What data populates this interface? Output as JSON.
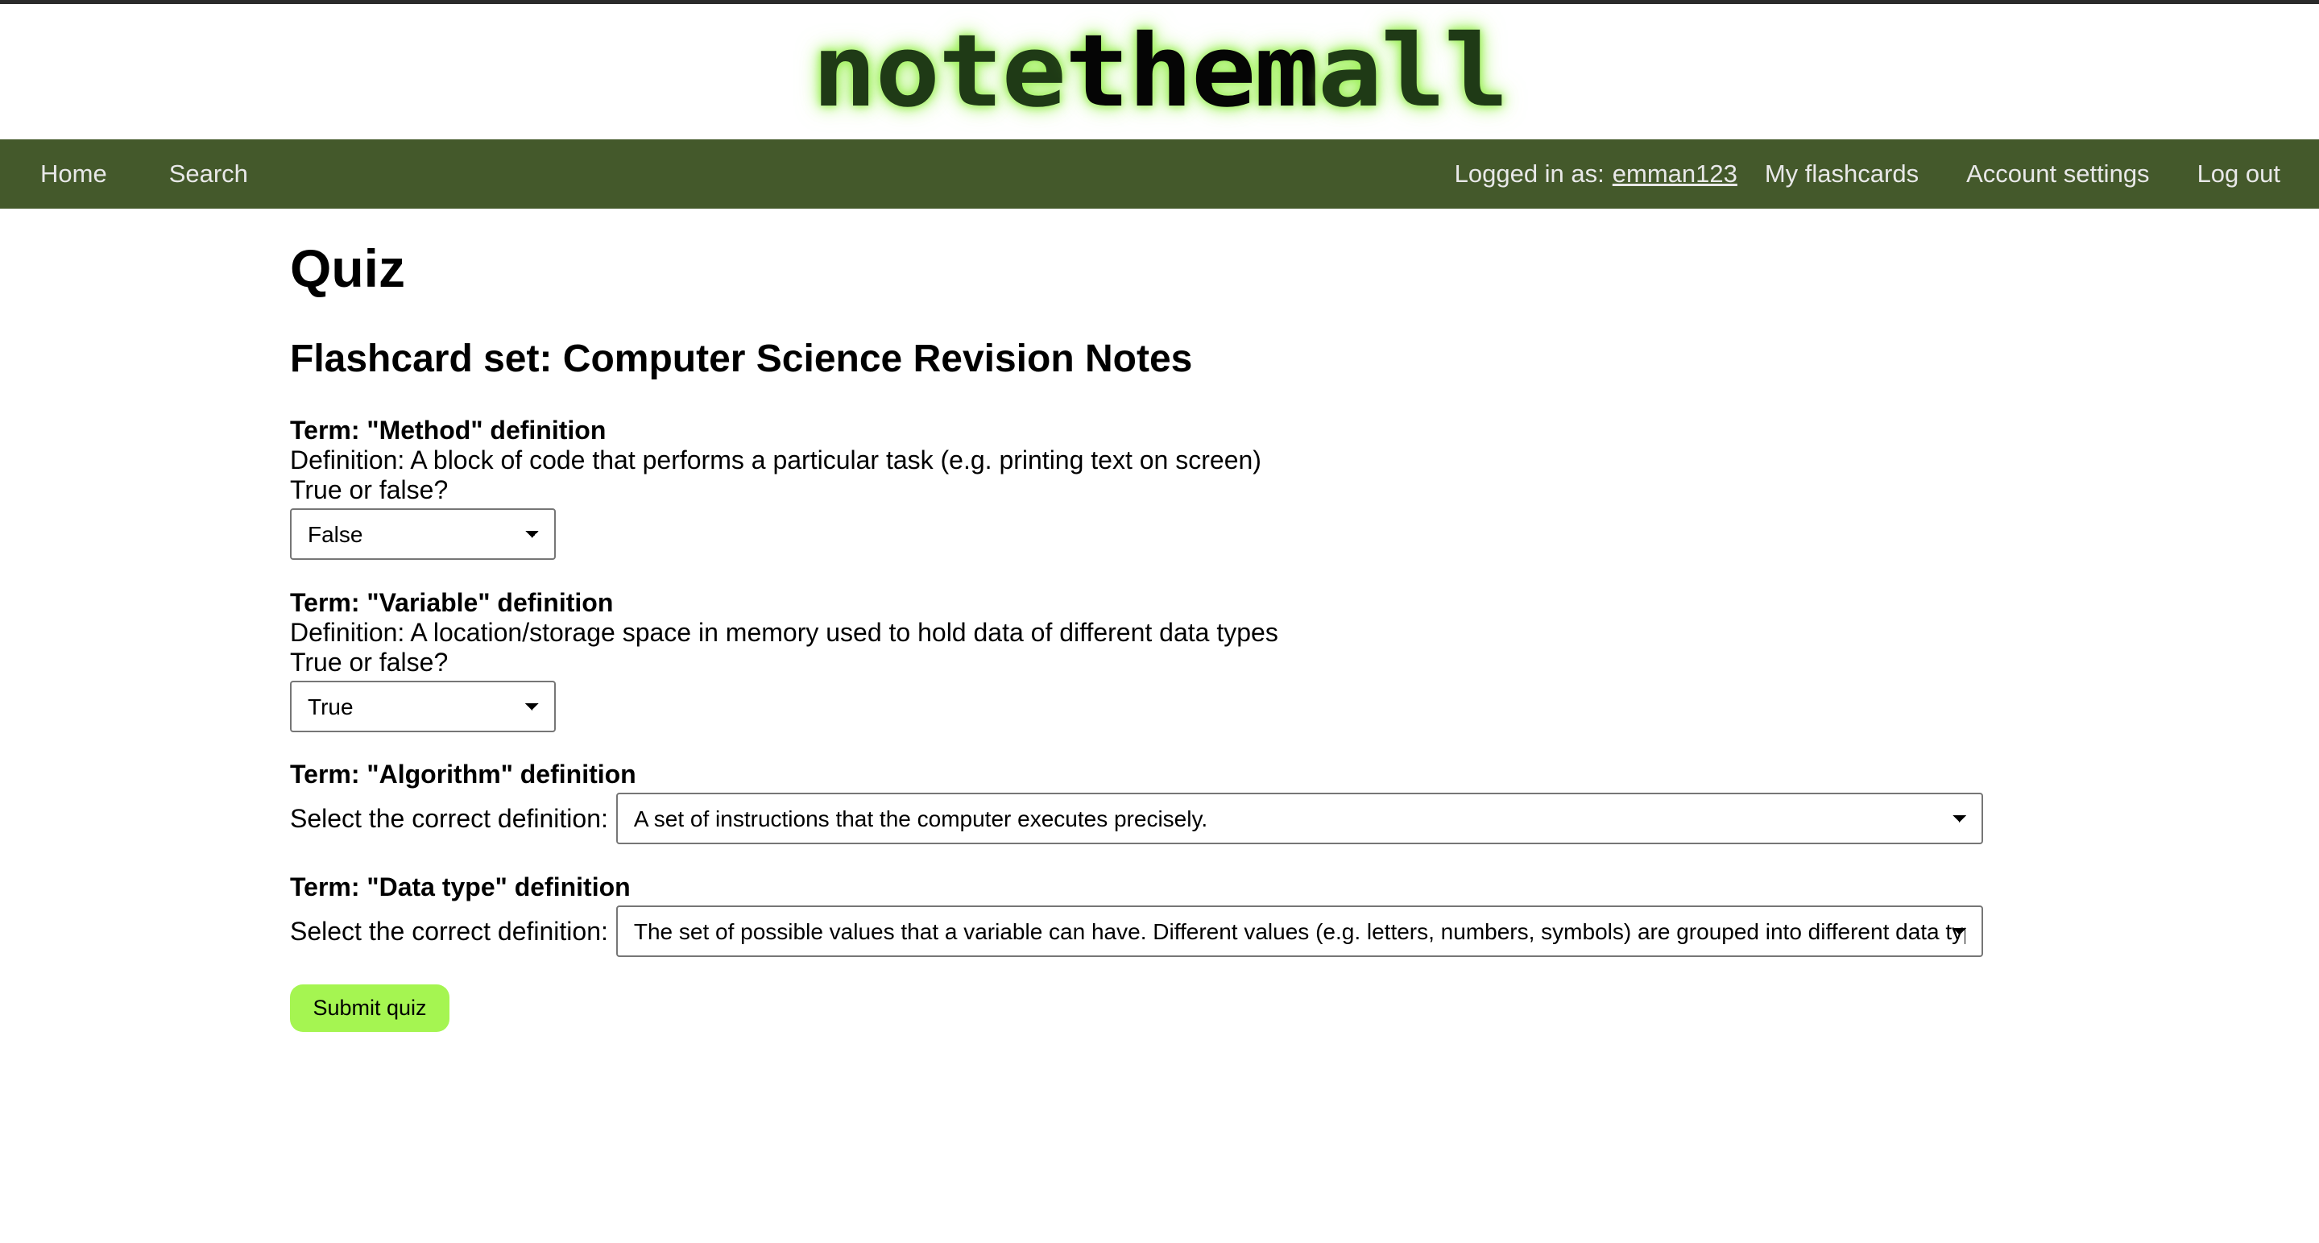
{
  "logo": {
    "part1": "note",
    "part2": "them",
    "part3": "all"
  },
  "nav": {
    "home": "Home",
    "search": "Search",
    "logged_in_label": "Logged in as:",
    "username": "emman123",
    "my_flashcards": "My flashcards",
    "account_settings": "Account settings",
    "log_out": "Log out"
  },
  "page": {
    "title": "Quiz",
    "subtitle": "Flashcard set: Computer Science Revision Notes"
  },
  "questions": [
    {
      "term": "Term: \"Method\" definition",
      "definition": "Definition: A block of code that performs a particular task (e.g. printing text on screen)",
      "prompt": "True or false?",
      "selected": "False"
    },
    {
      "term": "Term: \"Variable\" definition",
      "definition": "Definition: A location/storage space in memory used to hold data of different data types",
      "prompt": "True or false?",
      "selected": "True"
    },
    {
      "term": "Term: \"Algorithm\" definition",
      "prompt": "Select the correct definition:",
      "selected": "A set of instructions that the computer executes precisely."
    },
    {
      "term": "Term: \"Data type\" definition",
      "prompt": "Select the correct definition:",
      "selected": "The set of possible values that a variable can have. Different values (e.g. letters, numbers, symbols) are grouped into different data types."
    }
  ],
  "submit_label": "Submit quiz",
  "colors": {
    "nav_bg": "#44592b",
    "submit_bg": "#a5f551",
    "logo_glow": "#9ef05a"
  }
}
